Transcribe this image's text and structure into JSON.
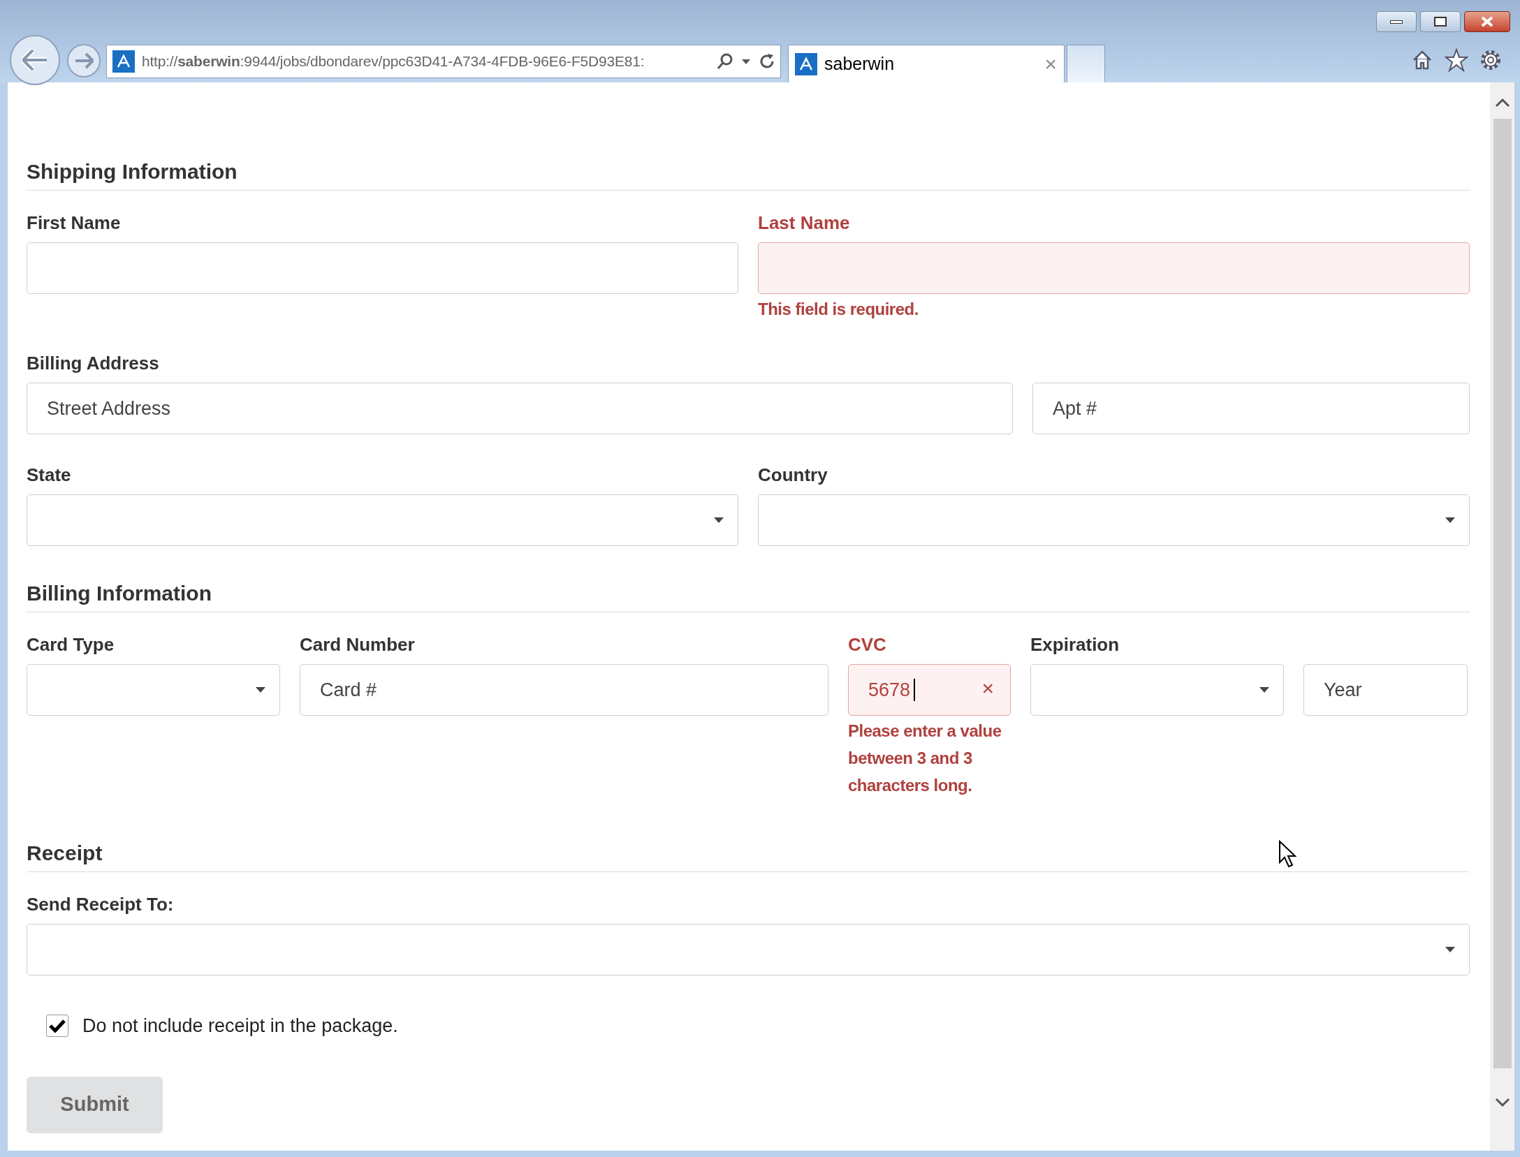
{
  "browser": {
    "address": "http://**saberwin**:9944/jobs/dbondarev/ppc63D41-A734-4FDB-96E6-F5D93E81:",
    "tabs": [
      {
        "title": "saberwin",
        "close": "×",
        "selected": true
      }
    ]
  },
  "sections": [
    {
      "title": "Shipping Information",
      "rows": [
        [
          {
            "label": "First Name",
            "invalid": false,
            "inputs": [
              {
                "kind": "text"
              }
            ]
          },
          {
            "label": "Last Name",
            "invalid": true,
            "error": "This field is required.",
            "inputs": [
              {
                "kind": "text"
              }
            ]
          }
        ],
        [
          {
            "label": "Billing Address",
            "invalid": false,
            "inputs": [
              {
                "kind": "text",
                "placeholder": "Street Address"
              },
              {
                "kind": "text",
                "placeholder": "Apt #"
              }
            ]
          }
        ],
        [
          {
            "label": "State",
            "invalid": false,
            "inputs": [
              {
                "kind": "select"
              }
            ]
          },
          {
            "label": "Country",
            "invalid": false,
            "inputs": [
              {
                "kind": "select"
              }
            ]
          }
        ]
      ]
    },
    {
      "title": "Billing Information",
      "rows": [
        [
          {
            "label": "Card Type",
            "invalid": false,
            "inputs": [
              {
                "kind": "select"
              }
            ]
          },
          {
            "label": "Card Number",
            "invalid": false,
            "inputs": [
              {
                "kind": "text",
                "placeholder": "Card #"
              }
            ]
          },
          {
            "label": "CVC",
            "invalid": true,
            "error": "Please enter a value between 3 and 3 characters long.",
            "inputs": [
              {
                "kind": "text",
                "value": "5678",
                "clear": "×",
                "focused": true
              }
            ]
          },
          {
            "label": "Expiration",
            "invalid": false,
            "inputs": [
              {
                "kind": "select"
              },
              {
                "kind": "text",
                "placeholder": "Year"
              }
            ]
          }
        ]
      ]
    },
    {
      "title": "Receipt",
      "rows": [
        [
          {
            "label": "Send Receipt To:",
            "invalid": false,
            "inputs": [
              {
                "kind": "select"
              }
            ]
          }
        ]
      ]
    }
  ],
  "checkbox": {
    "label": "Do not include receipt in the package.",
    "checked": true
  },
  "submit": {
    "label": "Submit",
    "disabled": true
  }
}
